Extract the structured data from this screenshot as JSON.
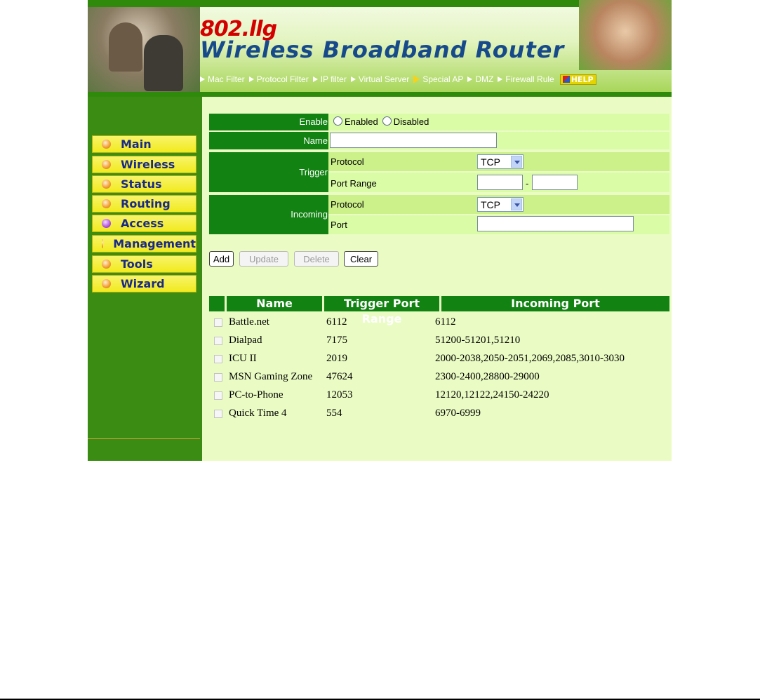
{
  "header": {
    "brand_line1": "802.llg",
    "brand_line2": "Wireless Broadband Router",
    "nav": [
      {
        "label": "Mac Filter"
      },
      {
        "label": "Protocol Filter"
      },
      {
        "label": "IP filter"
      },
      {
        "label": "Virtual Server"
      },
      {
        "label": "Special AP",
        "active": true
      },
      {
        "label": "DMZ"
      },
      {
        "label": "Firewall Rule"
      }
    ],
    "help_label": "HELP"
  },
  "sidebar": {
    "items": [
      {
        "label": "Main"
      },
      {
        "label": "Wireless"
      },
      {
        "label": "Status"
      },
      {
        "label": "Routing"
      },
      {
        "label": "Access",
        "active": true
      },
      {
        "label": "Management"
      },
      {
        "label": "Tools"
      },
      {
        "label": "Wizard"
      }
    ]
  },
  "form": {
    "enable_label": "Enable",
    "enabled_option": "Enabled",
    "disabled_option": "Disabled",
    "name_label": "Name",
    "name_value": "",
    "trigger_label": "Trigger",
    "trigger_protocol_label": "Protocol",
    "trigger_protocol_value": "TCP",
    "trigger_port_range_label": "Port Range",
    "trigger_port_from": "",
    "trigger_port_to": "",
    "range_separator": "-",
    "incoming_label": "Incoming",
    "incoming_protocol_label": "Protocol",
    "incoming_protocol_value": "TCP",
    "incoming_port_label": "Port",
    "incoming_port_value": ""
  },
  "buttons": {
    "add": "Add",
    "update": "Update",
    "delete": "Delete",
    "clear": "Clear"
  },
  "table": {
    "headers": [
      "Name",
      "Trigger Port Range",
      "Incoming Port"
    ],
    "rows": [
      {
        "name": "Battle.net",
        "trigger": "6112",
        "incoming": "6112"
      },
      {
        "name": "Dialpad",
        "trigger": "7175",
        "incoming": "51200-51201,51210"
      },
      {
        "name": "ICU II",
        "trigger": "2019",
        "incoming": "2000-2038,2050-2051,2069,2085,3010-3030"
      },
      {
        "name": "MSN Gaming Zone",
        "trigger": "47624",
        "incoming": "2300-2400,28800-29000"
      },
      {
        "name": "PC-to-Phone",
        "trigger": "12053",
        "incoming": "12120,12122,24150-24220"
      },
      {
        "name": "Quick Time 4",
        "trigger": "554",
        "incoming": "6970-6999"
      }
    ]
  },
  "colors": {
    "header_green": "#2f8a0c",
    "label_green": "#128212",
    "content_bg": "#eafcc4",
    "sidebar_button": "#f1ea1e",
    "brand_red": "#d40000",
    "brand_blue": "#174a8a"
  }
}
